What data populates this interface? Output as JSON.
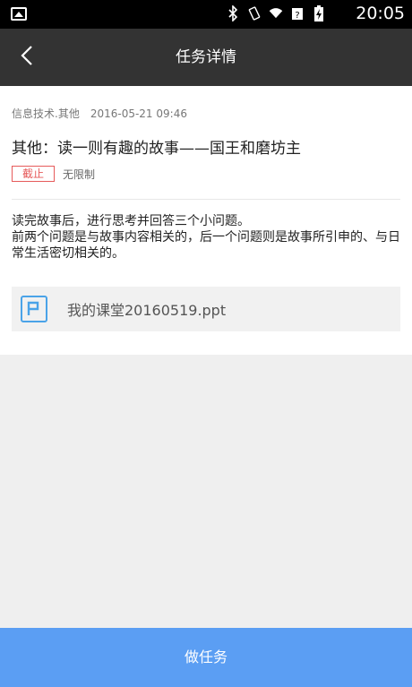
{
  "status_bar": {
    "time": "20:05"
  },
  "header": {
    "title": "任务详情",
    "back_icon": "chevron-left-icon"
  },
  "task": {
    "category": "信息技术.其他",
    "date": "2016-05-21 09:46",
    "title": "其他：读一则有趣的故事——国王和磨坊主",
    "deadline_label": "截止",
    "deadline_value": "无限制",
    "description": [
      "读完故事后，进行思考并回答三个小问题。",
      "前两个问题是与故事内容相关的，后一个问题则是故事所引申的、与日常生活密切相关的。"
    ],
    "attachment": {
      "name": "我的课堂20160519.ppt",
      "icon": "ppt-file-icon"
    }
  },
  "action": {
    "label": "做任务"
  },
  "colors": {
    "primary": "#5b9ef3",
    "deadline_red": "#e65a5a",
    "appbar": "#333333"
  }
}
